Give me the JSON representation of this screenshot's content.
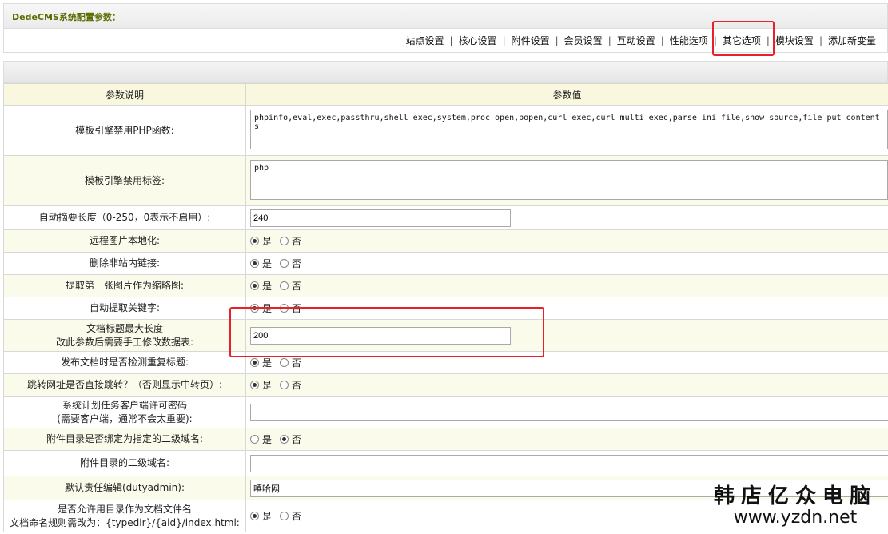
{
  "page_title": "DedeCMS系统配置参数：",
  "nav": [
    {
      "label": "站点设置"
    },
    {
      "label": "核心设置"
    },
    {
      "label": "附件设置"
    },
    {
      "label": "会员设置"
    },
    {
      "label": "互动设置"
    },
    {
      "label": "性能选项"
    },
    {
      "label": "其它选项",
      "highlighted": true
    },
    {
      "label": "模块设置"
    },
    {
      "label": "添加新变量"
    }
  ],
  "table": {
    "col_label": "参数说明",
    "col_value": "参数值",
    "rows": [
      {
        "label": "模板引擎禁用PHP函数:",
        "type": "textarea",
        "value": "phpinfo,eval,exec,passthru,shell_exec,system,proc_open,popen,curl_exec,curl_multi_exec,parse_ini_file,show_source,file_put_contents"
      },
      {
        "label": "模板引擎禁用标签:",
        "type": "textarea",
        "value": "php"
      },
      {
        "label": "自动摘要长度（0-250，0表示不启用）:",
        "type": "text",
        "value": "240"
      },
      {
        "label": "远程图片本地化:",
        "type": "radio",
        "selected": "yes"
      },
      {
        "label": "删除非站内链接:",
        "type": "radio",
        "selected": "yes"
      },
      {
        "label": "提取第一张图片作为缩略图:",
        "type": "radio",
        "selected": "yes"
      },
      {
        "label": "自动提取关键字:",
        "type": "radio",
        "selected": "yes"
      },
      {
        "label": "文档标题最大长度",
        "label2": "改此参数后需要手工修改数据表:",
        "type": "text",
        "value": "200",
        "highlighted": true
      },
      {
        "label": "发布文档时是否检测重复标题:",
        "type": "radio",
        "selected": "yes"
      },
      {
        "label": "跳转网址是否直接跳转？（否则显示中转页）:",
        "type": "radio",
        "selected": "yes"
      },
      {
        "label": "系统计划任务客户端许可密码",
        "label2": "(需要客户端，通常不会太重要):",
        "type": "text-long",
        "value": ""
      },
      {
        "label": "附件目录是否绑定为指定的二级域名:",
        "type": "radio",
        "selected": "no"
      },
      {
        "label": "附件目录的二级域名:",
        "type": "text-long",
        "value": ""
      },
      {
        "label": "默认责任编辑(dutyadmin):",
        "type": "text-long",
        "value": "嘻哈网"
      },
      {
        "label": "是否允许用目录作为文档文件名",
        "label2": "文档命名规则需改为：{typedir}/{aid}/index.html:",
        "type": "radio",
        "selected": "yes"
      }
    ]
  },
  "radio_labels": {
    "yes": "是",
    "no": "否"
  },
  "watermark": {
    "cn": "韩店亿众电脑",
    "url": "www.yzdn.net"
  },
  "colors": {
    "highlight": "#e8202a",
    "header_bg": "#f9f8df",
    "title_text": "#5b6a00"
  }
}
